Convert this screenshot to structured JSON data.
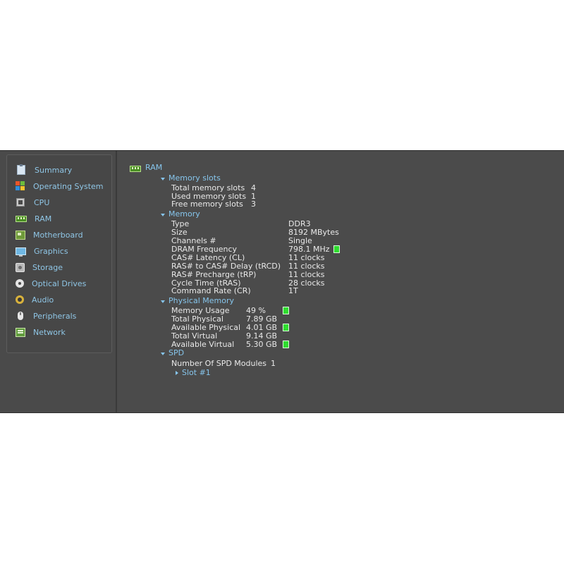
{
  "sidebar": {
    "items": [
      {
        "label": "Summary",
        "icon": "summary-icon"
      },
      {
        "label": "Operating System",
        "icon": "windows-logo-icon"
      },
      {
        "label": "CPU",
        "icon": "cpu-chip-icon"
      },
      {
        "label": "RAM",
        "icon": "ram-module-icon"
      },
      {
        "label": "Motherboard",
        "icon": "motherboard-icon"
      },
      {
        "label": "Graphics",
        "icon": "monitor-icon"
      },
      {
        "label": "Storage",
        "icon": "hard-drive-icon"
      },
      {
        "label": "Optical Drives",
        "icon": "optical-disc-icon"
      },
      {
        "label": "Audio",
        "icon": "speaker-icon"
      },
      {
        "label": "Peripherals",
        "icon": "mouse-icon"
      },
      {
        "label": "Network",
        "icon": "network-card-icon"
      }
    ]
  },
  "main": {
    "title": "RAM",
    "memory_slots": {
      "header": "Memory slots",
      "rows": [
        {
          "label": "Total memory slots",
          "value": "4"
        },
        {
          "label": "Used memory slots",
          "value": "1"
        },
        {
          "label": "Free memory slots",
          "value": "3"
        }
      ]
    },
    "memory": {
      "header": "Memory",
      "rows": [
        {
          "label": "Type",
          "value": "DDR3"
        },
        {
          "label": "Size",
          "value": "8192 MBytes"
        },
        {
          "label": "Channels #",
          "value": "Single"
        },
        {
          "label": "DRAM Frequency",
          "value": "798.1 MHz"
        },
        {
          "label": "CAS# Latency (CL)",
          "value": "11 clocks"
        },
        {
          "label": "RAS# to CAS# Delay (tRCD)",
          "value": "11 clocks"
        },
        {
          "label": "RAS# Precharge (tRP)",
          "value": "11 clocks"
        },
        {
          "label": "Cycle Time (tRAS)",
          "value": "28 clocks"
        },
        {
          "label": "Command Rate (CR)",
          "value": "1T"
        }
      ]
    },
    "physical_memory": {
      "header": "Physical Memory",
      "rows": [
        {
          "label": "Memory Usage",
          "value": "49 %"
        },
        {
          "label": "Total Physical",
          "value": "7.89 GB"
        },
        {
          "label": "Available Physical",
          "value": "4.01 GB"
        },
        {
          "label": "Total Virtual",
          "value": "9.14 GB"
        },
        {
          "label": "Available Virtual",
          "value": "5.30 GB"
        }
      ]
    },
    "spd": {
      "header": "SPD",
      "rows": [
        {
          "label": "Number Of SPD Modules",
          "value": "1"
        }
      ],
      "slot_label": "Slot #1"
    }
  },
  "colors": {
    "background": "#4b4b4b",
    "link_blue": "#86c5ec",
    "text": "#e9e9e9",
    "indicator_green": "#2fdc2f"
  }
}
